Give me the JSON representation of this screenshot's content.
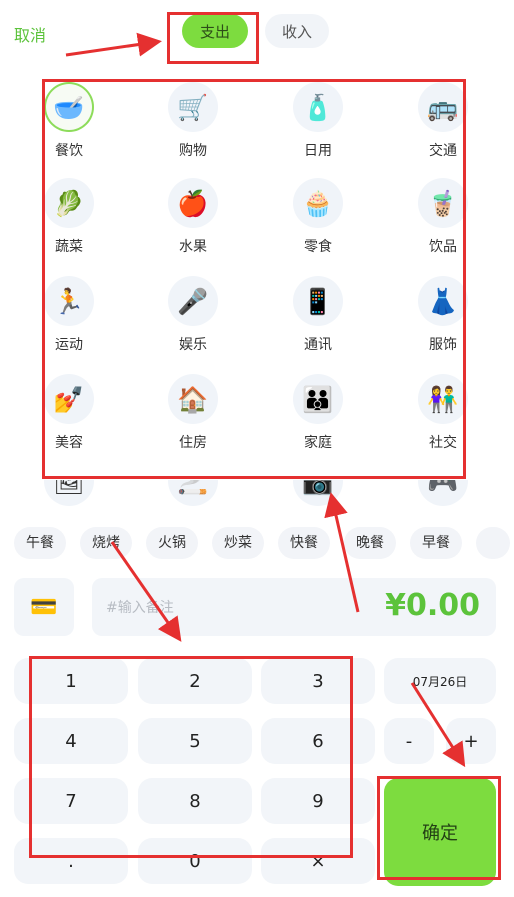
{
  "header": {
    "cancel_label": "取消",
    "tabs": [
      {
        "label": "支出",
        "active": true
      },
      {
        "label": "收入",
        "active": false
      }
    ]
  },
  "categories": [
    {
      "label": "餐饮",
      "icon": "🥣",
      "icon_name": "bowl-icon",
      "selected": true
    },
    {
      "label": "购物",
      "icon": "🛒",
      "icon_name": "shopping-cart-icon"
    },
    {
      "label": "日用",
      "icon": "🧴",
      "icon_name": "lotion-bottle-icon"
    },
    {
      "label": "交通",
      "icon": "🚌",
      "icon_name": "bus-icon"
    },
    {
      "label": "蔬菜",
      "icon": "🥬",
      "icon_name": "leafy-green-icon"
    },
    {
      "label": "水果",
      "icon": "🍎",
      "icon_name": "apple-icon"
    },
    {
      "label": "零食",
      "icon": "🧁",
      "icon_name": "cupcake-icon"
    },
    {
      "label": "饮品",
      "icon": "🧋",
      "icon_name": "bubble-tea-icon"
    },
    {
      "label": "运动",
      "icon": "🏃",
      "icon_name": "runner-icon"
    },
    {
      "label": "娱乐",
      "icon": "🎤",
      "icon_name": "microphone-icon"
    },
    {
      "label": "通讯",
      "icon": "📱",
      "icon_name": "mobile-phone-icon"
    },
    {
      "label": "服饰",
      "icon": "👗",
      "icon_name": "dress-icon"
    },
    {
      "label": "美容",
      "icon": "💅",
      "icon_name": "nail-polish-icon"
    },
    {
      "label": "住房",
      "icon": "🏠",
      "icon_name": "house-icon"
    },
    {
      "label": "家庭",
      "icon": "👪",
      "icon_name": "family-icon"
    },
    {
      "label": "社交",
      "icon": "👫",
      "icon_name": "couple-icon"
    }
  ],
  "categories_partial": [
    {
      "icon": "🖼",
      "icon_name": "picture-icon"
    },
    {
      "icon": "🚬",
      "icon_name": "cigarette-icon"
    },
    {
      "icon": "📷",
      "icon_name": "camera-icon"
    },
    {
      "icon": "🎮",
      "icon_name": "gamepad-icon"
    }
  ],
  "tags": [
    "午餐",
    "烧烤",
    "火锅",
    "炒菜",
    "快餐",
    "晚餐",
    "早餐"
  ],
  "payment": {
    "icon": "💳",
    "icon_name": "card-icon"
  },
  "note": {
    "placeholder": "#输入备注",
    "value": ""
  },
  "amount": "¥0.00",
  "keypad": {
    "keys": [
      "1",
      "2",
      "3",
      "4",
      "5",
      "6",
      "7",
      "8",
      "9",
      ".",
      "0",
      "×"
    ],
    "date": "07月26日",
    "minus": "-",
    "plus": "+",
    "confirm": "确定"
  },
  "colors": {
    "accent": "#7ddc3f",
    "accent_text": "#5cc33b",
    "annotation": "#e53030"
  }
}
